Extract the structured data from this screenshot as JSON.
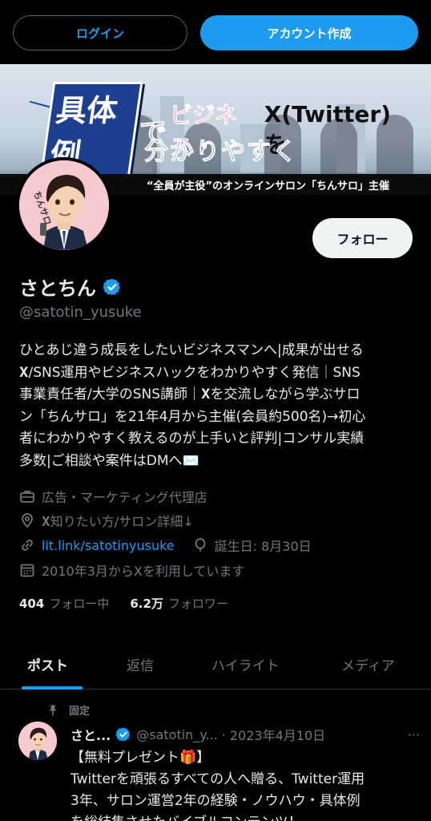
{
  "top_bar": {
    "login_label": "ログイン",
    "signup_label": "アカウント作成"
  },
  "banner": {
    "title_box": "具体例",
    "title_de": "で",
    "title_biz": "ビジネス・",
    "title_x": "X(Twitter)を",
    "title_line2": "分かりやすく",
    "strip_text": "“全員が主役”のオンラインサロン「ちんサロ」主催",
    "avatar_text": "ちんサロ"
  },
  "profile": {
    "follow_label": "フォロー",
    "display_name": "さとちん",
    "handle": "@satotin_yusuke",
    "bio": "ひとあじ違う成長をしたいビジネスマンへ|成果が出せる\n𝐗/SNS運用やビジネスハックをわかりやすく発信｜SNS\n事業責任者/大学のSNS講師｜𝐗を交流しながら学ぶサロ\nン「ちんサロ」を21年4月から主催(会員約500名)→初心\n者にわかりやすく教えるのが上手いと評判|コンサル実績\n多数|ご相談や案件はDMへ✉️",
    "category": "広告・マーケティング代理店",
    "location": "𝐗知りたい方/サロン詳細↓",
    "link": "lit.link/satotinyusuke",
    "birthday": "誕生日: 8月30日",
    "joined": "2010年3月からXを利用しています",
    "following_count": "404",
    "following_label": "フォロー中",
    "followers_count": "6.2万",
    "followers_label": "フォロワー"
  },
  "tabs": [
    {
      "label": "ポスト"
    },
    {
      "label": "返信"
    },
    {
      "label": "ハイライト"
    },
    {
      "label": "メディア"
    }
  ],
  "pinned_post": {
    "pinned_label": "固定",
    "name": "さと...",
    "handle": "@satotin_y...",
    "separator": "·",
    "date": "2023年4月10日",
    "more": "···",
    "body": "【無料プレゼント🎁】\nTwitterを頑張るすべての人へ贈る、Twitter運用\n3年、サロン運営2年の経験・ノウハウ・具体例\nを総結集させたバイブルコンテンツ！"
  },
  "colors": {
    "accent": "#1d9bf0",
    "background": "#000000",
    "muted": "#71767b",
    "text": "#e7e9ea"
  }
}
